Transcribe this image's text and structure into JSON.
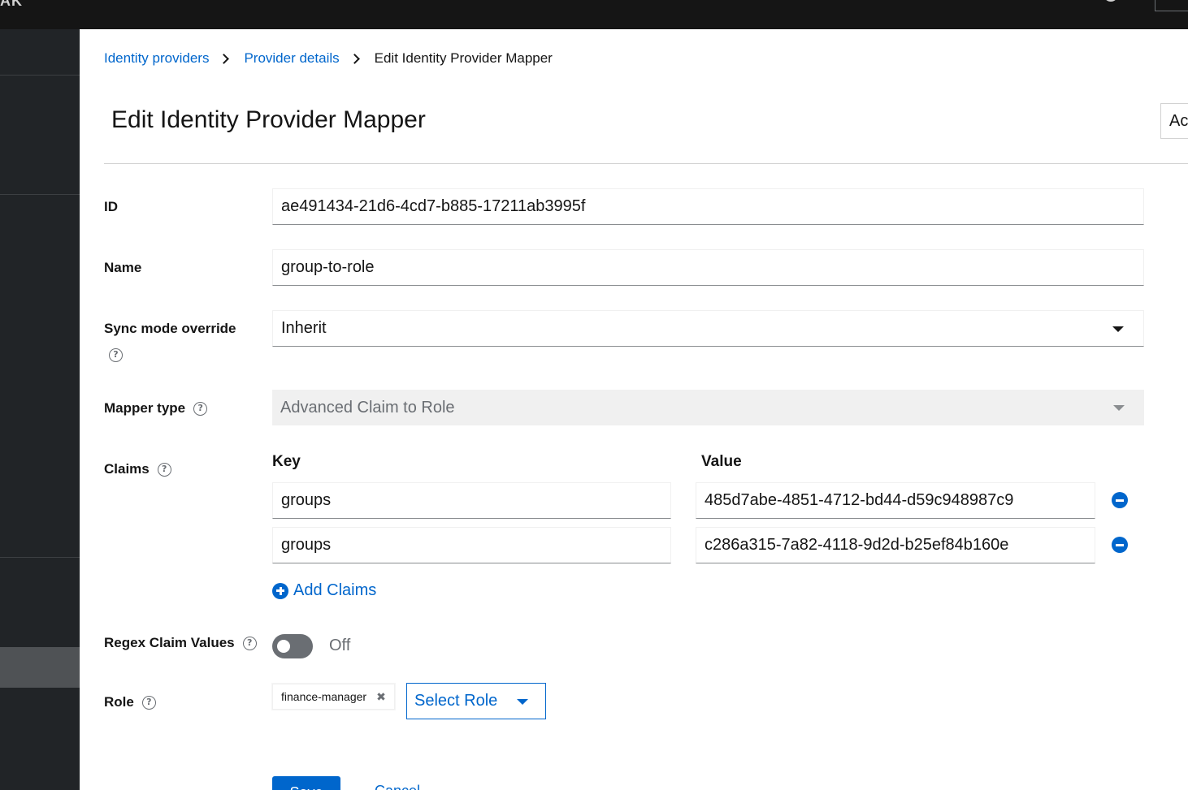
{
  "header": {
    "brand_fragment": "AK",
    "action_fragment": "Ac"
  },
  "breadcrumb": {
    "items": [
      "Identity providers",
      "Provider details"
    ],
    "current": "Edit Identity Provider Mapper"
  },
  "page": {
    "title": "Edit Identity Provider Mapper"
  },
  "form": {
    "id": {
      "label": "ID",
      "value": "ae491434-21d6-4cd7-b885-17211ab3995f"
    },
    "name": {
      "label": "Name",
      "value": "group-to-role"
    },
    "sync_mode": {
      "label": "Sync mode override",
      "value": "Inherit"
    },
    "mapper_type": {
      "label": "Mapper type",
      "value": "Advanced Claim to Role"
    },
    "claims": {
      "label": "Claims",
      "key_header": "Key",
      "value_header": "Value",
      "rows": [
        {
          "key": "groups",
          "value": "485d7abe-4851-4712-bd44-d59c948987c9"
        },
        {
          "key": "groups",
          "value": "c286a315-7a82-4118-9d2d-b25ef84b160e"
        }
      ],
      "add_label": "Add Claims"
    },
    "regex": {
      "label": "Regex Claim Values",
      "state": "Off",
      "enabled": false
    },
    "role": {
      "label": "Role",
      "chip": "finance-manager",
      "chip_remove": "✖",
      "select_label": "Select Role"
    }
  },
  "actions": {
    "save": "Save",
    "cancel": "Cancel"
  },
  "colors": {
    "accent": "#0066cc",
    "masthead": "#151515",
    "sidebar": "#212427"
  }
}
